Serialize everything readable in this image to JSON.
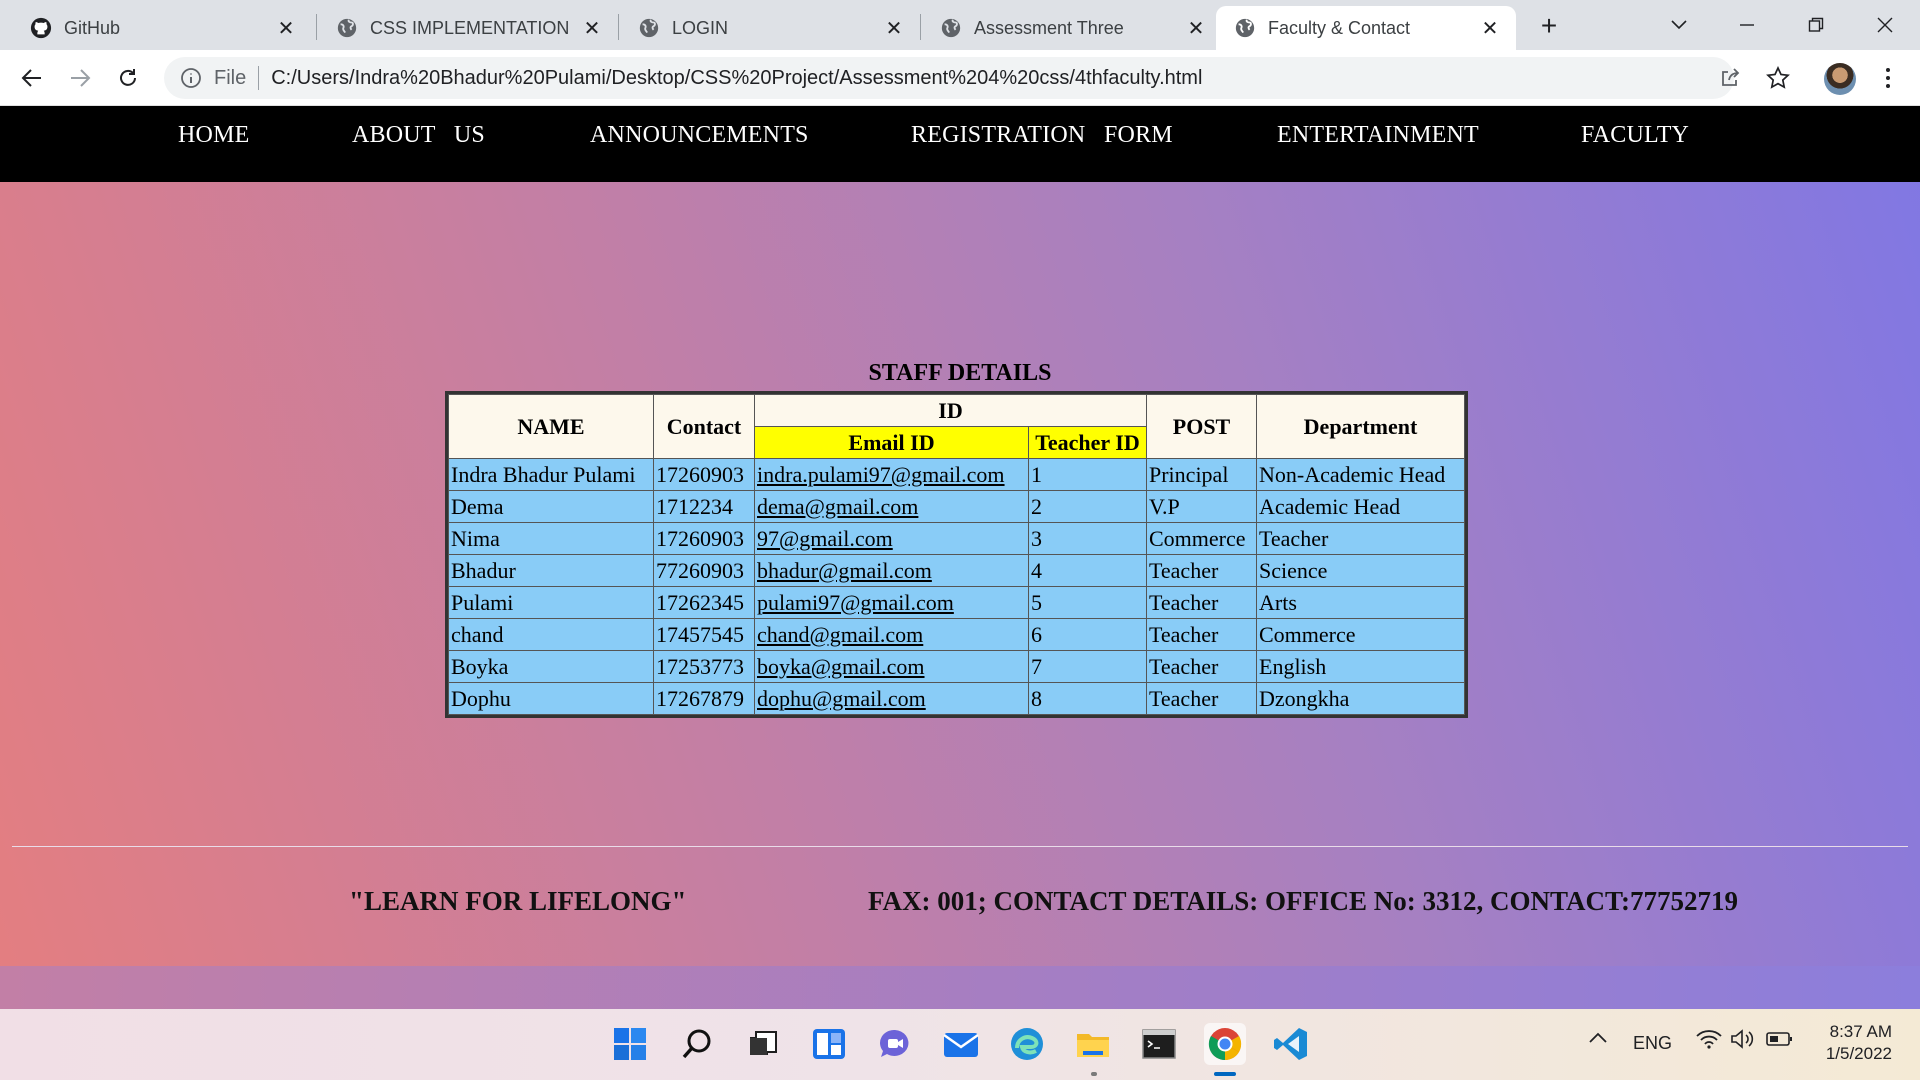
{
  "browser": {
    "tabs": [
      {
        "label": "GitHub",
        "icon": "github-icon",
        "active": false
      },
      {
        "label": "CSS IMPLEMENTATION",
        "icon": "globe-icon",
        "active": false
      },
      {
        "label": "LOGIN",
        "icon": "globe-icon",
        "active": false
      },
      {
        "label": "Assessment Three",
        "icon": "globe-icon",
        "active": false
      },
      {
        "label": "Faculty & Contact",
        "icon": "globe-icon",
        "active": true
      }
    ],
    "new_tab_label": "+",
    "scheme_label": "File",
    "url": "C:/Users/Indra%20Bhadur%20Pulami/Desktop/CSS%20Project/Assessment%204%20css/4thfaculty.html"
  },
  "page": {
    "nav": [
      "HOME",
      "ABOUT   US",
      "ANNOUNCEMENTS",
      "REGISTRATION   FORM",
      "ENTERTAINMENT",
      "FACULTY"
    ],
    "table": {
      "caption": "STAFF DETAILS",
      "headers": {
        "name": "NAME",
        "contact": "Contact",
        "id_group": "ID",
        "email": "Email ID",
        "teacher_id": "Teacher ID",
        "post": "POST",
        "department": "Department"
      },
      "rows": [
        {
          "name": "Indra Bhadur Pulami",
          "contact": "17260903",
          "email": "indra.pulami97@gmail.com",
          "teacher_id": "1",
          "post": "Principal",
          "department": "Non-Academic Head"
        },
        {
          "name": "Dema",
          "contact": "1712234",
          "email": "dema@gmail.com",
          "teacher_id": "2",
          "post": "V.P",
          "department": "Academic Head"
        },
        {
          "name": "Nima",
          "contact": "17260903",
          "email": "97@gmail.com",
          "teacher_id": "3",
          "post": "Commerce",
          "department": "Teacher"
        },
        {
          "name": "Bhadur",
          "contact": "77260903",
          "email": "bhadur@gmail.com",
          "teacher_id": "4",
          "post": "Teacher",
          "department": "Science"
        },
        {
          "name": "Pulami",
          "contact": "17262345",
          "email": "pulami97@gmail.com",
          "teacher_id": "5",
          "post": "Teacher",
          "department": "Arts"
        },
        {
          "name": "chand",
          "contact": "17457545",
          "email": "chand@gmail.com",
          "teacher_id": "6",
          "post": "Teacher",
          "department": "Commerce"
        },
        {
          "name": "Boyka",
          "contact": "17253773",
          "email": "boyka@gmail.com",
          "teacher_id": "7",
          "post": "Teacher",
          "department": "English"
        },
        {
          "name": "Dophu",
          "contact": "17267879",
          "email": "dophu@gmail.com",
          "teacher_id": "8",
          "post": "Teacher",
          "department": "Dzongkha"
        }
      ]
    },
    "footer": {
      "motto": "\"LEARN FOR LIFELONG\"",
      "contact": "FAX: 001; CONTACT DETAILS: OFFICE No: 3312, CONTACT:77752719"
    }
  },
  "taskbar": {
    "apps": [
      "start-icon",
      "search-icon",
      "task-view-icon",
      "widgets-icon",
      "chat-icon",
      "mail-icon",
      "edge-icon",
      "file-explorer-icon",
      "terminal-icon",
      "chrome-icon",
      "vscode-icon"
    ],
    "language": "ENG",
    "time": "8:37 AM",
    "date": "1/5/2022"
  },
  "colors": {
    "nav_bg": "#000000",
    "table_header_bg": "#fdf8ec",
    "table_highlight": "#ffff00",
    "table_row_bg": "#89ccf7",
    "page_gradient_start": "#e47e80",
    "page_gradient_end": "#8077e4"
  }
}
